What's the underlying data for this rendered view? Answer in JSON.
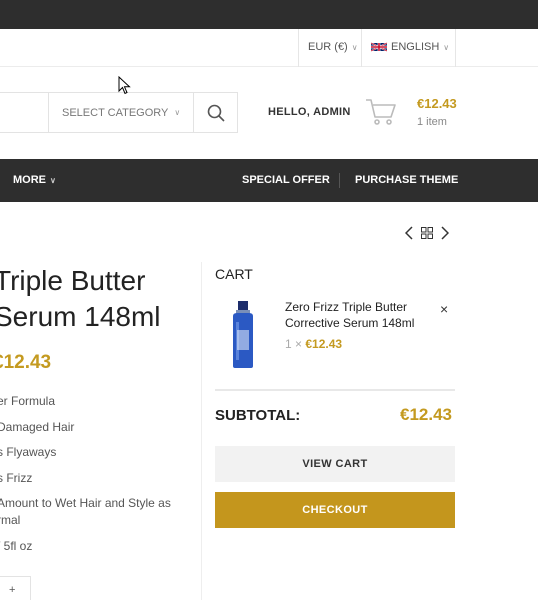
{
  "header": {
    "currency": "EUR (€)",
    "language": "ENGLISH",
    "category_label": "SELECT CATEGORY",
    "greeting": "HELLO, ADMIN",
    "cart_total": "€12.43",
    "cart_count": "1 item"
  },
  "nav": {
    "more": "MORE",
    "special_offer": "SPECIAL OFFER",
    "purchase_theme": "PURCHASE THEME"
  },
  "product": {
    "title_line1": "Triple Butter",
    "title_line2": "Serum 148ml",
    "price": "€12.43",
    "features": [
      "er Formula",
      "Damaged Hair",
      "s Flyaways",
      "s Frizz",
      "Amount to Wet Hair and Style as",
      "rmal",
      "/ 5fl oz"
    ],
    "qty_plus": "+"
  },
  "cart": {
    "heading": "CART",
    "item_name": "Zero Frizz Triple Butter Corrective Serum 148ml",
    "item_qty": "1 ×",
    "item_price": "€12.43",
    "remove": "×",
    "subtotal_label": "SUBTOTAL:",
    "subtotal_value": "€12.43",
    "view_cart": "VIEW CART",
    "checkout": "CHECKOUT"
  },
  "colors": {
    "accent": "#c49a20",
    "dark_bar": "#2e2e2e",
    "checkout_bg": "#c4961d"
  },
  "icons": [
    "search-icon",
    "cart-icon",
    "gb-flag-icon",
    "chevron-down-icon",
    "arrow-left-icon",
    "grid-icon",
    "arrow-right-icon",
    "close-icon",
    "cursor-icon"
  ]
}
